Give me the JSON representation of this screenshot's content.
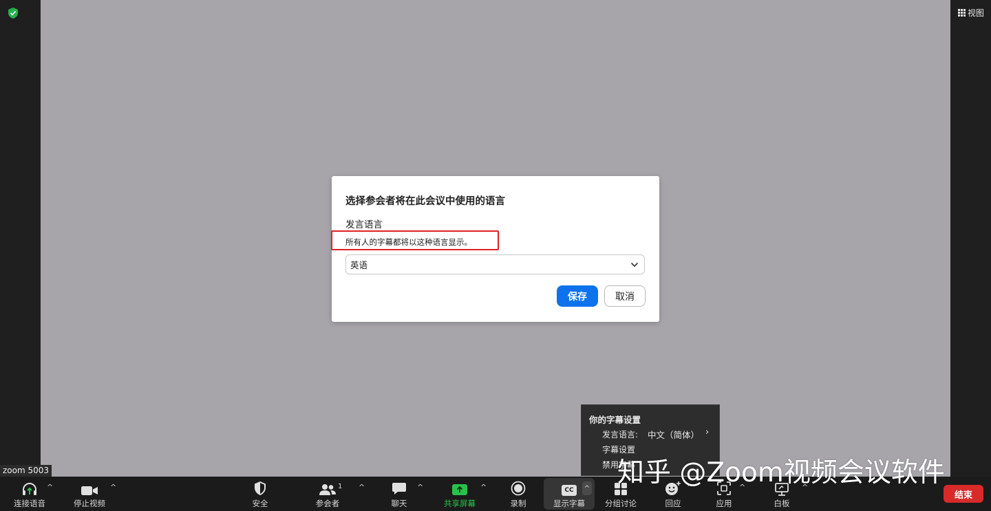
{
  "view_button": {
    "label": "视图"
  },
  "name_tag": "zoom 5003",
  "dialog": {
    "title": "选择参会者将在此会议中使用的语言",
    "subtitle": "发言语言",
    "hint": "所有人的字幕都将以这种语言显示。",
    "selected_language": "英语",
    "save_label": "保存",
    "cancel_label": "取消"
  },
  "caption_menu": {
    "heading": "你的字幕设置",
    "speak_language_label": "发言语言:",
    "speak_language_value": "中文（简体）",
    "settings_label": "字幕设置",
    "disable_label": "禁用字幕"
  },
  "watermark": "知乎 @Zoom视频会议软件",
  "toolbar": {
    "audio": "连接语音",
    "video": "停止视频",
    "security": "安全",
    "participants": "参会者",
    "participants_count": "1",
    "chat": "聊天",
    "share": "共享屏幕",
    "record": "录制",
    "captions": "显示字幕",
    "cc_text": "CC",
    "breakout": "分组讨论",
    "reactions": "回应",
    "apps": "应用",
    "whiteboard": "白板",
    "end": "结束"
  },
  "colors": {
    "accent_blue": "#0e72ed",
    "end_red": "#d92a2a",
    "share_green": "#28c24b",
    "highlight_red": "#e02020",
    "shield_green": "#22b14c"
  }
}
